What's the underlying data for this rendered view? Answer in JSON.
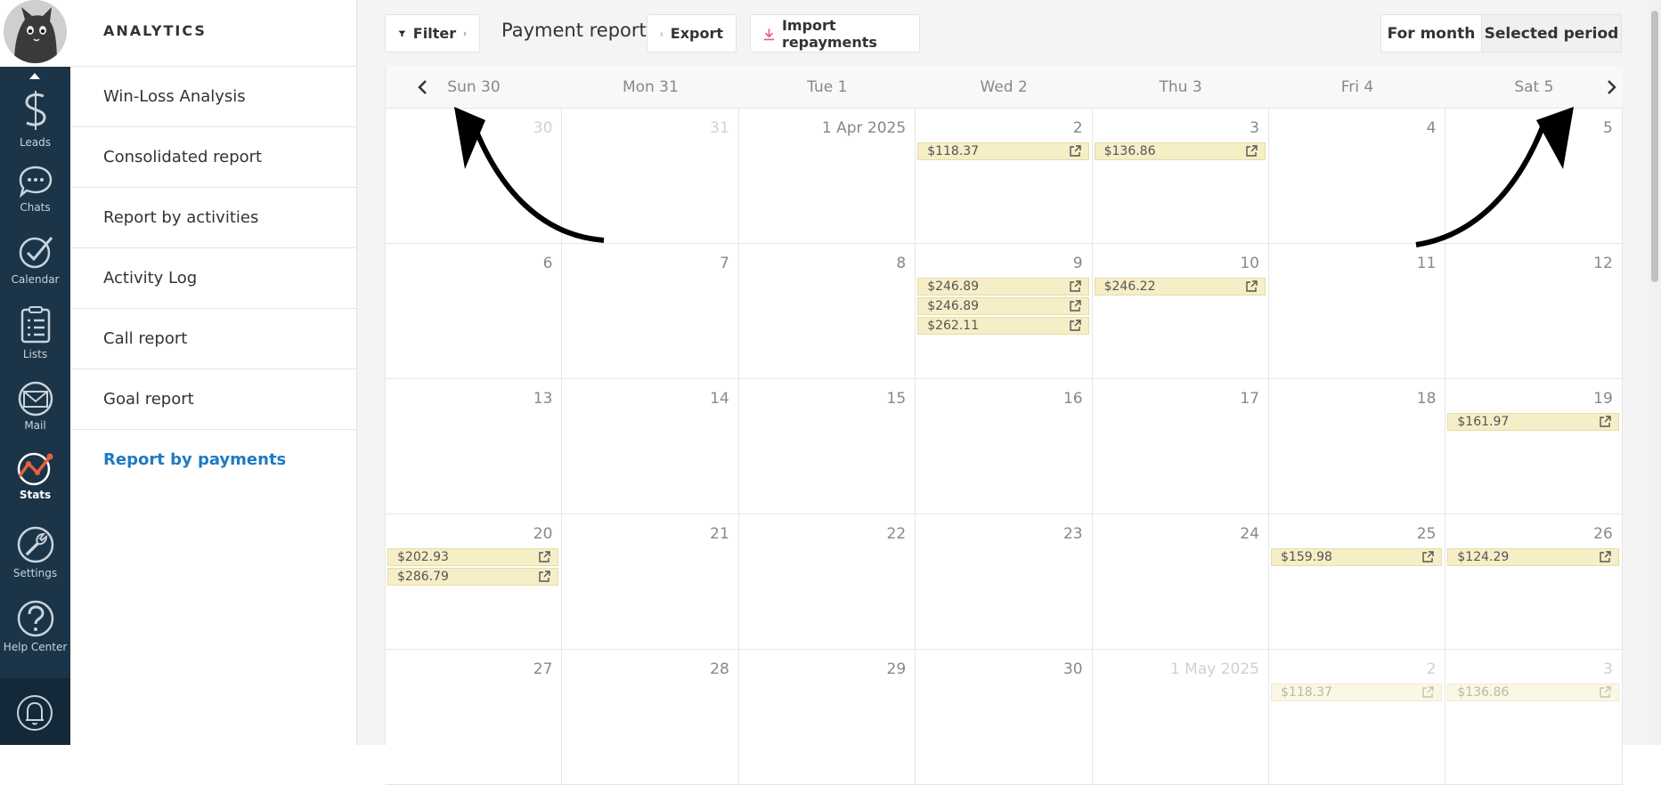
{
  "rail": {
    "items": [
      {
        "label": "Leads",
        "icon": "leads-icon"
      },
      {
        "label": "Chats",
        "icon": "chat-bubble-icon"
      },
      {
        "label": "Calendar",
        "icon": "checkmark-icon"
      },
      {
        "label": "Lists",
        "icon": "list-icon"
      },
      {
        "label": "Mail",
        "icon": "mail-icon"
      },
      {
        "label": "Stats",
        "icon": "stats-icon"
      },
      {
        "label": "Settings",
        "icon": "wrench-icon"
      },
      {
        "label": "Help Center",
        "icon": "question-icon"
      }
    ],
    "active": "Stats"
  },
  "sidebar": {
    "title": "ANALYTICS",
    "items": [
      {
        "label": "Win-Loss Analysis"
      },
      {
        "label": "Consolidated report"
      },
      {
        "label": "Report by activities"
      },
      {
        "label": "Activity Log"
      },
      {
        "label": "Call report"
      },
      {
        "label": "Goal report"
      },
      {
        "label": "Report by payments"
      }
    ],
    "active": "Report by payments"
  },
  "toolbar": {
    "filter_label": "Filter",
    "title": "Payment report",
    "export_label": "Export",
    "import_label": "Import repayments",
    "for_month_label": "For month",
    "selected_period_label": "Selected period"
  },
  "calendar": {
    "weekdays": [
      "Sun 30",
      "Mon 31",
      "Tue 1",
      "Wed 2",
      "Thu 3",
      "Fri 4",
      "Sat 5"
    ],
    "weeks": [
      [
        {
          "day": "30",
          "dim": true,
          "payments": []
        },
        {
          "day": "31",
          "dim": true,
          "payments": []
        },
        {
          "day": "1 Apr 2025",
          "payments": []
        },
        {
          "day": "2",
          "payments": [
            "$118.37"
          ]
        },
        {
          "day": "3",
          "payments": [
            "$136.86"
          ]
        },
        {
          "day": "4",
          "payments": []
        },
        {
          "day": "5",
          "payments": []
        }
      ],
      [
        {
          "day": "6",
          "payments": []
        },
        {
          "day": "7",
          "payments": []
        },
        {
          "day": "8",
          "payments": []
        },
        {
          "day": "9",
          "payments": [
            "$246.89",
            "$246.89",
            "$262.11"
          ]
        },
        {
          "day": "10",
          "payments": [
            "$246.22"
          ]
        },
        {
          "day": "11",
          "payments": []
        },
        {
          "day": "12",
          "payments": []
        }
      ],
      [
        {
          "day": "13",
          "payments": []
        },
        {
          "day": "14",
          "payments": []
        },
        {
          "day": "15",
          "payments": []
        },
        {
          "day": "16",
          "payments": []
        },
        {
          "day": "17",
          "payments": []
        },
        {
          "day": "18",
          "payments": []
        },
        {
          "day": "19",
          "payments": [
            "$161.97"
          ]
        }
      ],
      [
        {
          "day": "20",
          "payments": [
            "$202.93",
            "$286.79"
          ]
        },
        {
          "day": "21",
          "payments": []
        },
        {
          "day": "22",
          "payments": []
        },
        {
          "day": "23",
          "payments": []
        },
        {
          "day": "24",
          "payments": []
        },
        {
          "day": "25",
          "payments": [
            "$159.98"
          ]
        },
        {
          "day": "26",
          "payments": [
            "$124.29"
          ]
        }
      ],
      [
        {
          "day": "27",
          "payments": []
        },
        {
          "day": "28",
          "payments": []
        },
        {
          "day": "29",
          "payments": []
        },
        {
          "day": "30",
          "payments": []
        },
        {
          "day": "1 May 2025",
          "dim": true,
          "payments": []
        },
        {
          "day": "2",
          "dim": true,
          "payments": [
            "$118.37"
          ]
        },
        {
          "day": "3",
          "dim": true,
          "payments": [
            "$136.86"
          ]
        }
      ]
    ]
  },
  "colors": {
    "rail_bg": "#1b3447",
    "active_link": "#1e7ac2",
    "payment_bg": "#f6eec7",
    "export_icon": "#2fa56b",
    "import_icon": "#e0607a"
  }
}
